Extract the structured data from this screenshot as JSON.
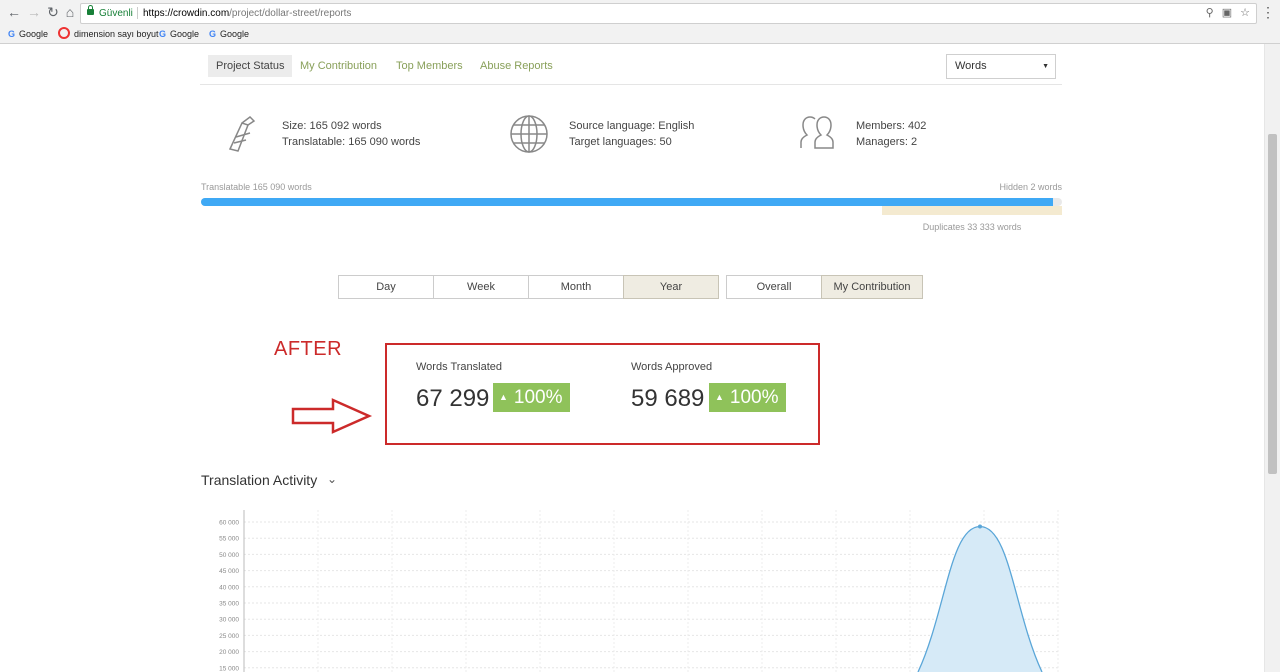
{
  "browser": {
    "secure_label": "Güvenli",
    "url_scheme_host": "https://crowdin.com",
    "url_path": "/project/dollar-street/reports",
    "bookmarks": [
      {
        "label": "Google",
        "icon": "google-icon"
      },
      {
        "label": "dimension sayı boyut",
        "icon": "bookmark-site-icon"
      },
      {
        "label": "Google",
        "icon": "google-icon"
      },
      {
        "label": "Google",
        "icon": "google-icon"
      }
    ]
  },
  "report_tabs": [
    {
      "label": "Project Status",
      "active": true
    },
    {
      "label": "My Contribution",
      "active": false
    },
    {
      "label": "Top Members",
      "active": false
    },
    {
      "label": "Abuse Reports",
      "active": false
    }
  ],
  "unit_select": {
    "value": "Words"
  },
  "stats": {
    "size": "Size: 165 092 words",
    "translatable": "Translatable: 165 090 words",
    "source_language": "Source language: English",
    "target_languages": "Target languages: 50",
    "members": "Members: 402",
    "managers": "Managers: 2"
  },
  "progress": {
    "left_label": "Translatable 165 090 words",
    "right_label": "Hidden 2 words",
    "duplicates_label": "Duplicates 33 333 words",
    "translatable_fraction": 0.99,
    "duplicates_fraction": 0.21
  },
  "period_buttons": [
    {
      "label": "Day",
      "active": false
    },
    {
      "label": "Week",
      "active": false
    },
    {
      "label": "Month",
      "active": false
    },
    {
      "label": "Year",
      "active": true
    }
  ],
  "scope_buttons": [
    {
      "label": "Overall",
      "active": false
    },
    {
      "label": "My Contribution",
      "active": true
    }
  ],
  "annotation": {
    "label": "AFTER",
    "color": "#cc2a2a"
  },
  "metrics": [
    {
      "title": "Words Translated",
      "value": "67 299",
      "change": "100%"
    },
    {
      "title": "Words Approved",
      "value": "59 689",
      "change": "100%"
    }
  ],
  "colors": {
    "accent_green": "#89a05a",
    "badge_green": "#8fc25a",
    "progress_blue": "#3fa9f5",
    "chart_blue": "#5aa6d8"
  },
  "activity": {
    "title": "Translation Activity"
  },
  "chart_data": {
    "type": "area",
    "y_ticks": [
      "60 000",
      "55 000",
      "50 000",
      "45 000",
      "40 000",
      "35 000",
      "30 000",
      "25 000",
      "20 000",
      "15 000"
    ],
    "ylim": [
      15000,
      60000
    ],
    "grid": true,
    "x": [
      0,
      1,
      2,
      3,
      4,
      5,
      6,
      7,
      8,
      9,
      10,
      11
    ],
    "values": [
      0,
      0,
      0,
      0,
      0,
      0,
      0,
      0,
      0,
      0,
      58600,
      0
    ],
    "peak_point": {
      "x": 10,
      "y": 58600
    }
  }
}
